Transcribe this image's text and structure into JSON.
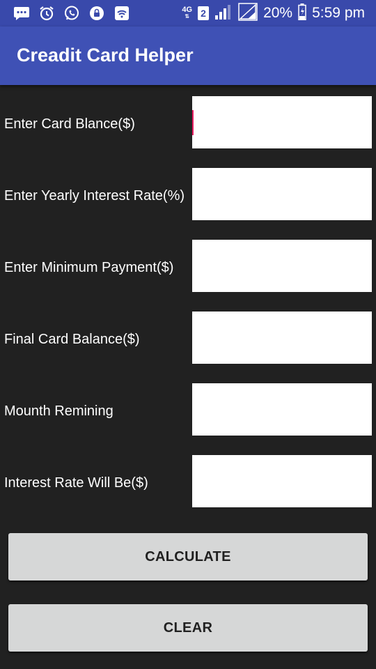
{
  "status_bar": {
    "icons": [
      "message-icon",
      "alarm-icon",
      "whatsapp-icon",
      "lock-icon",
      "wifi-icon",
      "sim-icon",
      "signal-icon",
      "signal-empty-icon",
      "battery-icon"
    ],
    "network_type": "4G",
    "sim_slot": "2",
    "battery": "20%",
    "time": "5:59 pm"
  },
  "app_bar": {
    "title": "Creadit Card Helper"
  },
  "form": {
    "fields": [
      {
        "label": "Enter Card Blance($)",
        "value": ""
      },
      {
        "label": "Enter Yearly Interest Rate(%)",
        "value": ""
      },
      {
        "label": "Enter Minimum Payment($)",
        "value": ""
      },
      {
        "label": "Final Card Balance($)",
        "value": ""
      },
      {
        "label": "Mounth Remining",
        "value": ""
      },
      {
        "label": "Interest Rate Will Be($)",
        "value": ""
      }
    ]
  },
  "buttons": {
    "calculate": "CALCULATE",
    "clear": "CLEAR"
  },
  "colors": {
    "primary": "#3f51b5",
    "primary_dark": "#3949ab",
    "accent": "#e91e63",
    "background": "#212121",
    "button": "#d6d7d7"
  }
}
